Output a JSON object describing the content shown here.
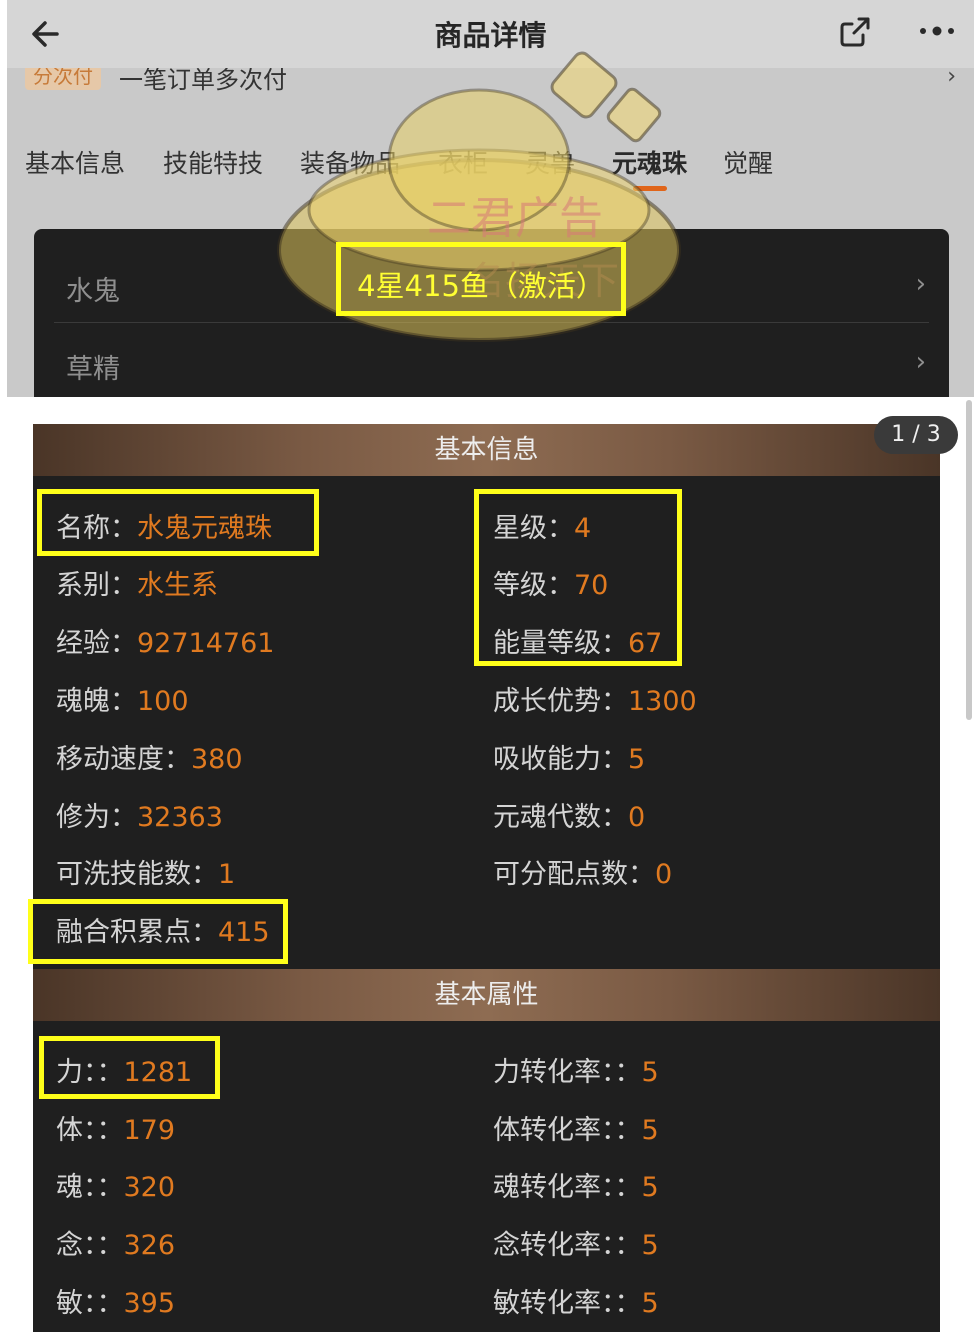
{
  "header": {
    "title": "商品详情",
    "back_icon": "back-arrow-icon",
    "share_icon": "share-icon",
    "more_icon": "more-icon"
  },
  "banner": {
    "tag": "分次付",
    "text": "一笔订单多次付",
    "arrow": "›"
  },
  "tabs": [
    {
      "label": "基本信息"
    },
    {
      "label": "技能特技"
    },
    {
      "label": "装备物品"
    },
    {
      "label": "衣柜"
    },
    {
      "label": "灵兽"
    },
    {
      "label": "元魂珠",
      "active": true
    },
    {
      "label": "觉醒"
    }
  ],
  "list": [
    {
      "label": "水鬼",
      "chevron": "›"
    },
    {
      "label": "草精",
      "chevron": "›"
    }
  ],
  "watermark": {
    "line1": "二君广告",
    "line2": "名扬天下"
  },
  "annotation": {
    "text": "4星415鱼（激活）"
  },
  "pager": "1 / 3",
  "basic_info": {
    "title": "基本信息",
    "fields": [
      {
        "label": "名称：",
        "value": "水鬼元魂珠"
      },
      {
        "label": "星级：",
        "value": "4"
      },
      {
        "label": "系别：",
        "value": "水生系"
      },
      {
        "label": "等级：",
        "value": "70"
      },
      {
        "label": "经验：",
        "value": "92714761"
      },
      {
        "label": "能量等级：",
        "value": "67"
      },
      {
        "label": "魂魄：",
        "value": "100"
      },
      {
        "label": "成长优势：",
        "value": "1300"
      },
      {
        "label": "移动速度：",
        "value": "380"
      },
      {
        "label": "吸收能力：",
        "value": "5"
      },
      {
        "label": "修为：",
        "value": "32363"
      },
      {
        "label": "元魂代数：",
        "value": "0"
      },
      {
        "label": "可洗技能数：",
        "value": "1"
      },
      {
        "label": "可分配点数：",
        "value": "0"
      },
      {
        "label": "融合积累点：",
        "value": "415"
      }
    ]
  },
  "basic_attr": {
    "title": "基本属性",
    "fields": [
      {
        "label": "力：：",
        "value": "1281"
      },
      {
        "label": "力转化率：：",
        "value": "5"
      },
      {
        "label": "体：：",
        "value": "179"
      },
      {
        "label": "体转化率：：",
        "value": "5"
      },
      {
        "label": "魂：：",
        "value": "320"
      },
      {
        "label": "魂转化率：：",
        "value": "5"
      },
      {
        "label": "念：：",
        "value": "326"
      },
      {
        "label": "念转化率：：",
        "value": "5"
      },
      {
        "label": "敏：：",
        "value": "395"
      },
      {
        "label": "敏转化率：：",
        "value": "5"
      }
    ]
  },
  "colors": {
    "value": "#e07a20",
    "label": "#d4d4d4",
    "highlight": "#ffff1a",
    "accent": "#e0651a"
  }
}
